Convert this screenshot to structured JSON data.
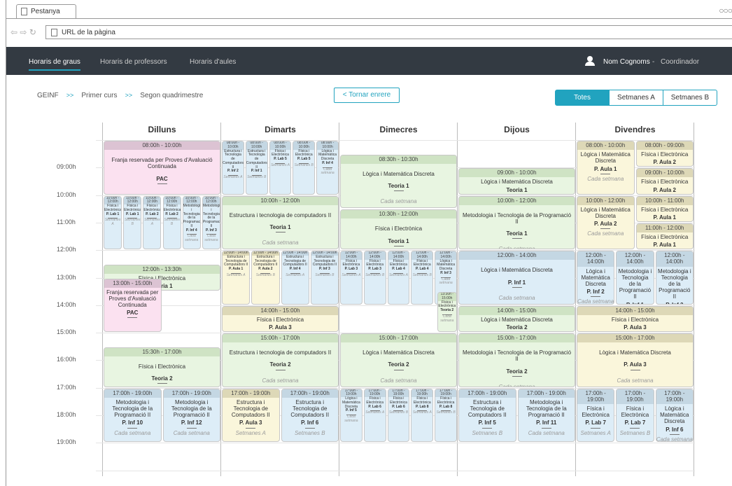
{
  "browser": {
    "tab_title": "Pestanya",
    "url_placeholder": "URL de la pàgina"
  },
  "nav": {
    "items": [
      "Horaris de graus",
      "Horaris de professors",
      "Horaris d'aules"
    ],
    "user_name": "Nom Cognoms",
    "user_sep": "-",
    "user_role": "Coordinador"
  },
  "breadcrumb": {
    "items": [
      "GEINF",
      "Primer curs",
      "Segon quadrimestre"
    ],
    "sep": ">>"
  },
  "back_label": "< Tornar enrere",
  "filters": [
    "Totes",
    "Setmanes A",
    "Setmanes B"
  ],
  "filters_selected": "Totes",
  "days": [
    "Dilluns",
    "Dimarts",
    "Dimecres",
    "Dijous",
    "Divendres"
  ],
  "hours": [
    "09:00h",
    "10:00h",
    "11:00h",
    "12:00h",
    "13:00h",
    "14:00h",
    "15:00h",
    "16:00h",
    "17:00h",
    "18:00h",
    "19:00h"
  ],
  "events": [
    {
      "d": 0,
      "c": 0,
      "w": 1,
      "s": 8,
      "e": 10,
      "h": "08:00h - 10:00h",
      "n": "Franja reservada per Proves d'Avaluació Continuada",
      "r": "PAC",
      "f": "",
      "k": "p"
    },
    {
      "d": 0,
      "c": 0,
      "w": 1,
      "s": 12.5,
      "e": 13.5,
      "h": "12:00h - 13:30h",
      "n": "Física i Electrònica",
      "r": "Teoria 1",
      "f": "Cada setmana",
      "k": "g"
    },
    {
      "d": 0,
      "c": 0,
      "w": 0.5,
      "s": 13,
      "e": 15,
      "h": "13:00h - 15:00h",
      "n": "Franja reservada per Proves d'Avaluació Continuada",
      "r": "PAC",
      "f": "",
      "k": "p"
    },
    {
      "d": 0,
      "c": 0,
      "w": 1,
      "s": 15.5,
      "e": 17,
      "h": "15:30h - 17:00h",
      "n": "Física i Electrònica",
      "r": "Teoria 2",
      "f": "Cada setmana",
      "k": "g"
    },
    {
      "d": 0,
      "c": 0,
      "w": 0.5,
      "s": 17,
      "e": 19,
      "h": "17:00h - 19:00h",
      "n": "Metodologia i Tecnologia de la Programació II",
      "r": "P. Inf 10",
      "f": "Cada setmana",
      "k": "b"
    },
    {
      "d": 0,
      "c": 0.5,
      "w": 0.5,
      "s": 17,
      "e": 19,
      "h": "17:00h - 19:00h",
      "n": "Metodologia i Tecnologia de la Programació II",
      "r": "P. Inf 12",
      "f": "Cada setmana",
      "k": "b"
    },
    {
      "d": 0,
      "c": 0,
      "w": 0.1667,
      "s": 10,
      "e": 12,
      "h": "10:00h - 12:00h",
      "n": "Física i Electrònica",
      "r": "P. Lab 1",
      "f": "Setmanes A",
      "k": "bt"
    },
    {
      "d": 0,
      "c": 0.1667,
      "w": 0.1667,
      "s": 10,
      "e": 12,
      "h": "10:00h - 12:00h",
      "n": "Física i Electrònica",
      "r": "P. Lab 1",
      "f": "Setmanes B",
      "k": "bt"
    },
    {
      "d": 0,
      "c": 0.3333,
      "w": 0.1667,
      "s": 10,
      "e": 12,
      "h": "10:00h - 12:00h",
      "n": "Física i Electrònica",
      "r": "P. Lab 2",
      "f": "Setmanes A",
      "k": "bt"
    },
    {
      "d": 0,
      "c": 0.5,
      "w": 0.1667,
      "s": 10,
      "e": 12,
      "h": "10:00h - 12:00h",
      "n": "Física i Electrònica",
      "r": "P. Lab 2",
      "f": "Setmanes B",
      "k": "bt"
    },
    {
      "d": 0,
      "c": 0.6667,
      "w": 0.1667,
      "s": 10,
      "e": 12,
      "h": "10:00h - 12:00h",
      "n": "Metodologia i Tecnologia de la Programació II",
      "r": "P. Inf 4",
      "f": "Cada setmana",
      "k": "bt"
    },
    {
      "d": 0,
      "c": 0.8333,
      "w": 0.1667,
      "s": 10,
      "e": 12,
      "h": "10:00h - 12:00h",
      "n": "Metodologia i Tecnologia de la Programació II",
      "r": "P. Inf 3",
      "f": "Cada setmana",
      "k": "bt"
    },
    {
      "d": 1,
      "c": 0,
      "w": 0.2,
      "s": 8,
      "e": 10,
      "h": "08:00h - 10:00h",
      "n": "Estructura i Tecnologia de Computadors II",
      "r": "P. Inf 2",
      "f": "Setmanes A",
      "k": "bt"
    },
    {
      "d": 1,
      "c": 0.2,
      "w": 0.2,
      "s": 8,
      "e": 10,
      "h": "08:00h - 10:00h",
      "n": "Estructura i Tecnologia de Computadors II",
      "r": "P. Inf 1",
      "f": "Setmanes B",
      "k": "bt"
    },
    {
      "d": 1,
      "c": 0.4,
      "w": 0.2,
      "s": 8,
      "e": 10,
      "h": "08:00h - 10:00h",
      "n": "Física i Electrònica",
      "r": "P. Lab 5",
      "f": "Setmanes A",
      "k": "bt"
    },
    {
      "d": 1,
      "c": 0.6,
      "w": 0.2,
      "s": 8,
      "e": 10,
      "h": "08:00h - 10:00h",
      "n": "Física i Electrònica",
      "r": "P. Lab 5",
      "f": "Setmanes B",
      "k": "bt"
    },
    {
      "d": 1,
      "c": 0.8,
      "w": 0.2,
      "s": 8,
      "e": 10,
      "h": "08:00h - 10:00h",
      "n": "Lògica i Matemàtica Discreta",
      "r": "P. Inf 4",
      "f": "Cada setmana",
      "k": "bt"
    },
    {
      "d": 1,
      "c": 0,
      "w": 1,
      "s": 10,
      "e": 12,
      "h": "10:00h - 12:00h",
      "n": "Estructura i tecnologia de computadors II",
      "r": "Teoria 1",
      "f": "Cada setmana",
      "k": "g"
    },
    {
      "d": 1,
      "c": 0,
      "w": 0.25,
      "s": 12,
      "e": 14,
      "h": "12:00h - 14:00h",
      "n": "Estructura i Tecnologia de Computadors II",
      "r": "P. Aula 1",
      "f": "Setmanes A",
      "k": "yt"
    },
    {
      "d": 1,
      "c": 0.25,
      "w": 0.25,
      "s": 12,
      "e": 14,
      "h": "12:00h - 14:00h",
      "n": "Estructura i Tecnologia de Computadors II",
      "r": "P. Aula 2",
      "f": "Setmanes B",
      "k": "yt"
    },
    {
      "d": 1,
      "c": 0.5,
      "w": 0.25,
      "s": 12,
      "e": 14,
      "h": "12:00h - 14:00h",
      "n": "Estructura i Tecnologia de Computadors II",
      "r": "P. Inf 4",
      "f": "Setmanes A",
      "k": "bt"
    },
    {
      "d": 1,
      "c": 0.75,
      "w": 0.25,
      "s": 12,
      "e": 14,
      "h": "12:00h - 14:00h",
      "n": "Estructura i Tecnologia de Computadors II",
      "r": "P. Inf 3",
      "f": "Setmanes B",
      "k": "bt"
    },
    {
      "d": 1,
      "c": 0,
      "w": 1,
      "s": 14,
      "e": 15,
      "h": "14:00h - 15:00h",
      "n": "Física i Electrònica",
      "r": "P. Aula 3",
      "f": "Cada setmana",
      "k": "y"
    },
    {
      "d": 1,
      "c": 0,
      "w": 1,
      "s": 15,
      "e": 17,
      "h": "15:00h - 17:00h",
      "n": "Estructura i tecnologia de computadors II",
      "r": "Teoria 2",
      "f": "Cada setmana",
      "k": "g"
    },
    {
      "d": 1,
      "c": 0,
      "w": 0.5,
      "s": 17,
      "e": 19,
      "h": "17:00h - 19:00h",
      "n": "Estructura i Tecnologia de Computadors II",
      "r": "P. Aula 3",
      "f": "Setmanes A",
      "k": "y"
    },
    {
      "d": 1,
      "c": 0.5,
      "w": 0.5,
      "s": 17,
      "e": 19,
      "h": "17:00h - 19:00h",
      "n": "Estructura i Tecnologia de Computadors II",
      "r": "P. Inf 6",
      "f": "Setmanes B",
      "k": "b"
    },
    {
      "d": 2,
      "c": 0,
      "w": 1,
      "s": 8.5,
      "e": 10.5,
      "h": "08:30h - 10:30h",
      "n": "Lògica i Matemàtica Discreta",
      "r": "Teoria 1",
      "f": "Cada setmana",
      "k": "g"
    },
    {
      "d": 2,
      "c": 0,
      "w": 1,
      "s": 10.5,
      "e": 12,
      "h": "10:30h - 12:00h",
      "n": "Física i Electrònica",
      "r": "Teoria 1",
      "f": "Cada setmana",
      "k": "g"
    },
    {
      "d": 2,
      "c": 0,
      "w": 0.2,
      "s": 12,
      "e": 14,
      "h": "12:00h - 14:00h",
      "n": "Física i Electrònica",
      "r": "P. Lab 3",
      "f": "Setmanes A",
      "k": "bt"
    },
    {
      "d": 2,
      "c": 0.2,
      "w": 0.2,
      "s": 12,
      "e": 14,
      "h": "12:00h - 14:00h",
      "n": "Física i Electrònica",
      "r": "P. Lab 3",
      "f": "Setmanes B",
      "k": "bt"
    },
    {
      "d": 2,
      "c": 0.4,
      "w": 0.2,
      "s": 12,
      "e": 14,
      "h": "12:00h - 14:00h",
      "n": "Física i Electrònica",
      "r": "P. Lab 4",
      "f": "Setmanes A",
      "k": "bt"
    },
    {
      "d": 2,
      "c": 0.6,
      "w": 0.2,
      "s": 12,
      "e": 14,
      "h": "12:00h - 14:00h",
      "n": "Física i Electrònica",
      "r": "P. Lab 4",
      "f": "Setmanes B",
      "k": "bt"
    },
    {
      "d": 2,
      "c": 0.8,
      "w": 0.2,
      "s": 12,
      "e": 14,
      "h": "12:00h - 14:00h",
      "n": "Lògica i Matemàtica Discreta",
      "r": "P. Inf 3",
      "f": "Cada setmana",
      "k": "bt"
    },
    {
      "d": 2,
      "c": 0.82,
      "w": 0.18,
      "s": 13.5,
      "e": 15,
      "h": "13:30h - 15:00h",
      "n": "Física i Electrònica",
      "r": "Teoria 2",
      "f": "Cada setmana",
      "k": "gt"
    },
    {
      "d": 2,
      "c": 0,
      "w": 1,
      "s": 15,
      "e": 17,
      "h": "15:00h - 17:00h",
      "n": "Lògica i Matemàtica Discreta",
      "r": "Teoria 2",
      "f": "Cada setmana",
      "k": "g"
    },
    {
      "d": 2,
      "c": 0,
      "w": 0.2,
      "s": 17,
      "e": 19,
      "h": "17:00h - 19:00h",
      "n": "Lògica i Matemàtica Discreta",
      "r": "P. Inf 5",
      "f": "Cada setmana",
      "k": "bt"
    },
    {
      "d": 2,
      "c": 0.2,
      "w": 0.2,
      "s": 17,
      "e": 19,
      "h": "17:00h - 19:00h",
      "n": "Física i Electrònica",
      "r": "P. Lab 6",
      "f": "Setmanes A",
      "k": "bt"
    },
    {
      "d": 2,
      "c": 0.4,
      "w": 0.2,
      "s": 17,
      "e": 19,
      "h": "17:00h - 19:00h",
      "n": "Física i Electrònica",
      "r": "P. Lab 6",
      "f": "Setmanes B",
      "k": "bt"
    },
    {
      "d": 2,
      "c": 0.6,
      "w": 0.2,
      "s": 17,
      "e": 19,
      "h": "17:00h - 19:00h",
      "n": "Física i Electrònica",
      "r": "P. Lab 8",
      "f": "Setmanes A",
      "k": "bt"
    },
    {
      "d": 2,
      "c": 0.8,
      "w": 0.2,
      "s": 17,
      "e": 19,
      "h": "17:00h - 19:00h",
      "n": "Física i Electrònica",
      "r": "P. Lab 8",
      "f": "Setmanes B",
      "k": "bt"
    },
    {
      "d": 3,
      "c": 0,
      "w": 1,
      "s": 9,
      "e": 10,
      "h": "09:00h - 10:00h",
      "n": "Lògica i Matemàtica Discreta",
      "r": "Teoria 1",
      "f": "Cada setmana",
      "k": "g"
    },
    {
      "d": 3,
      "c": 0,
      "w": 1,
      "s": 10,
      "e": 12,
      "h": "10:00h - 12:00h",
      "n": "Metodologia i Tecnologia de la Programació II",
      "r": "Teoria 1",
      "f": "Cada setmana",
      "k": "g"
    },
    {
      "d": 3,
      "c": 0,
      "w": 1,
      "s": 12,
      "e": 14,
      "h": "12:00h - 14:00h",
      "n": "Lògica i Matemàtica Discreta",
      "r": "P. Inf 1",
      "f": "Cada setmana",
      "k": "b"
    },
    {
      "d": 3,
      "c": 0,
      "w": 1,
      "s": 14,
      "e": 15,
      "h": "14:00h - 15:00h",
      "n": "Lògica i Matemàtica Discreta",
      "r": "Teoria 2",
      "f": "Cada setmana",
      "k": "g"
    },
    {
      "d": 3,
      "c": 0,
      "w": 1,
      "s": 15,
      "e": 17,
      "h": "15:00h - 17:00h",
      "n": "Metodologia i Tecnologia de la Programació II",
      "r": "Teoria 2",
      "f": "Cada setmana",
      "k": "g"
    },
    {
      "d": 3,
      "c": 0,
      "w": 0.5,
      "s": 17,
      "e": 19,
      "h": "17:00h - 19:00h",
      "n": "Estructura i Tecnologia de Computadors II",
      "r": "P. Inf 5",
      "f": "Setmanes B",
      "k": "b"
    },
    {
      "d": 3,
      "c": 0.5,
      "w": 0.5,
      "s": 17,
      "e": 19,
      "h": "17:00h - 19:00h",
      "n": "Metodologia i Tecnologia de la Programació II",
      "r": "P. Inf 11",
      "f": "Cada setmana",
      "k": "b"
    },
    {
      "d": 4,
      "c": 0,
      "w": 0.5,
      "s": 8,
      "e": 10,
      "h": "08:00h - 10:00h",
      "n": "Lògica i Matemàtica Discreta",
      "r": "P. Aula 1",
      "f": "Cada setmana",
      "k": "y"
    },
    {
      "d": 4,
      "c": 0.5,
      "w": 0.5,
      "s": 8,
      "e": 9,
      "h": "08:00h - 09:00h",
      "n": "Física i Electrònica",
      "r": "P. Aula 2",
      "f": "Cada setmana",
      "k": "y"
    },
    {
      "d": 4,
      "c": 0.5,
      "w": 0.5,
      "s": 9,
      "e": 10,
      "h": "09:00h - 10:00h",
      "n": "Física i Electrònica",
      "r": "P. Aula 2",
      "f": "Cada setmana",
      "k": "y"
    },
    {
      "d": 4,
      "c": 0,
      "w": 0.5,
      "s": 10,
      "e": 12,
      "h": "10:00h - 12:00h",
      "n": "Lògica i Matemàtica Discreta",
      "r": "P. Aula 2",
      "f": "Cada setmana",
      "k": "y"
    },
    {
      "d": 4,
      "c": 0.5,
      "w": 0.5,
      "s": 10,
      "e": 11,
      "h": "10:00h - 11:00h",
      "n": "Física i Electrònica",
      "r": "P. Aula 1",
      "f": "Cada setmana",
      "k": "y"
    },
    {
      "d": 4,
      "c": 0.5,
      "w": 0.5,
      "s": 11,
      "e": 12,
      "h": "11:00h - 12:00h",
      "n": "Física i Electrònica",
      "r": "P. Aula 1",
      "f": "Cada setmana",
      "k": "y"
    },
    {
      "d": 4,
      "c": 0,
      "w": 0.3333,
      "s": 12,
      "e": 14,
      "h": "12:00h - 14:00h",
      "n": "Lògica i Matemàtica Discreta",
      "r": "P. Inf 2",
      "f": "Cada setmana",
      "k": "b"
    },
    {
      "d": 4,
      "c": 0.3333,
      "w": 0.3333,
      "s": 12,
      "e": 14,
      "h": "12:00h - 14:00h",
      "n": "Metodologia i Tecnologia de la Programació II",
      "r": "P. Inf 1",
      "f": "Cada setmana",
      "k": "b"
    },
    {
      "d": 4,
      "c": 0.6667,
      "w": 0.3333,
      "s": 12,
      "e": 14,
      "h": "12:00h - 14:00h",
      "n": "Metodologia i Tecnologia de la Programació II",
      "r": "P. Inf 2",
      "f": "Cada setmana",
      "k": "b"
    },
    {
      "d": 4,
      "c": 0,
      "w": 1,
      "s": 14,
      "e": 15,
      "h": "14:00h - 15:00h",
      "n": "Física i Electrònica",
      "r": "P. Aula 3",
      "f": "Cada setmana",
      "k": "y"
    },
    {
      "d": 4,
      "c": 0,
      "w": 1,
      "s": 15,
      "e": 17,
      "h": "15:00h - 17:00h",
      "n": "Lògica i Matemàtica Discreta",
      "r": "P. Aula 3",
      "f": "Cada setmana",
      "k": "y"
    },
    {
      "d": 4,
      "c": 0,
      "w": 0.3333,
      "s": 17,
      "e": 19,
      "h": "17:00h - 19:00h",
      "n": "Física i Electrònica",
      "r": "P. Lab 7",
      "f": "Setmanes A",
      "k": "b"
    },
    {
      "d": 4,
      "c": 0.3333,
      "w": 0.3333,
      "s": 17,
      "e": 19,
      "h": "17:00h - 19:00h",
      "n": "Física i Electrònica",
      "r": "P. Lab 7",
      "f": "Setmanes B",
      "k": "b"
    },
    {
      "d": 4,
      "c": 0.6667,
      "w": 0.3333,
      "s": 17,
      "e": 19,
      "h": "17:00h - 19:00h",
      "n": "Lògica i Matemàtica Discreta",
      "r": "P. Inf 6",
      "f": "Cada setmana",
      "k": "b"
    }
  ]
}
